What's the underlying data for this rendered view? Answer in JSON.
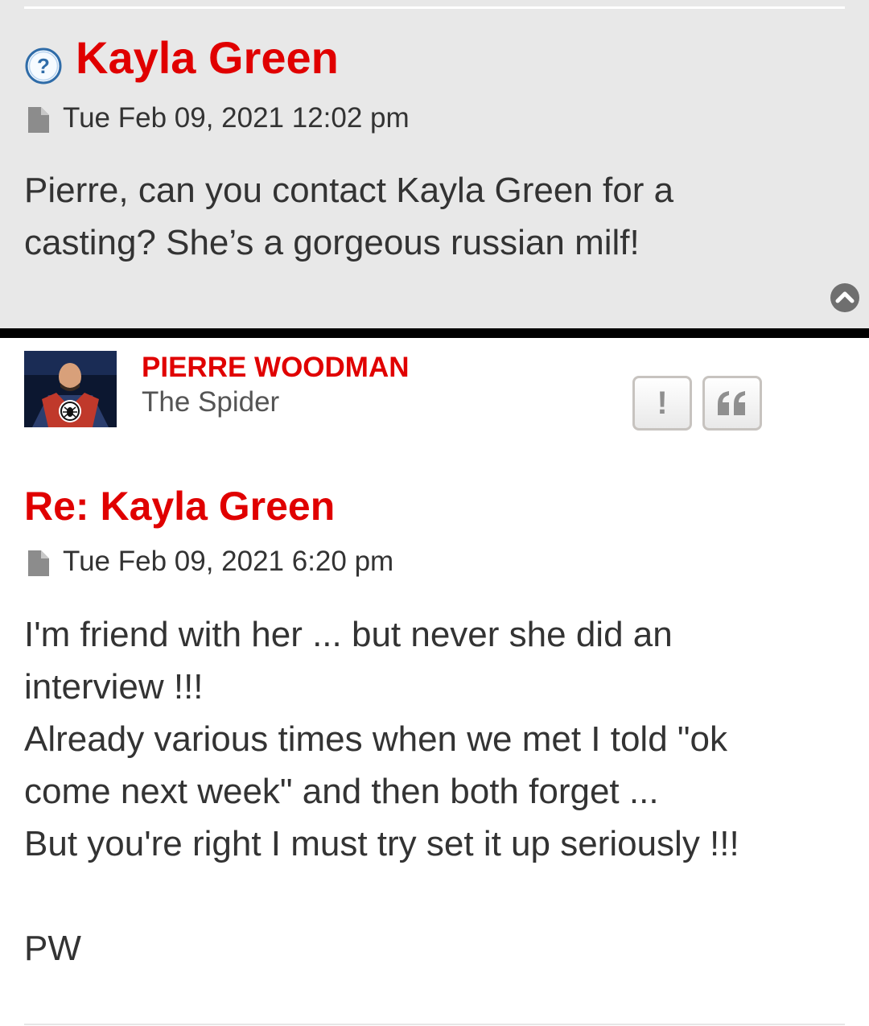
{
  "post1": {
    "title": "Kayla Green",
    "date": "Tue Feb 09, 2021 12:02 pm",
    "body_lines": [
      "Pierre, can you contact Kayla Green for a",
      "casting? She’s a gorgeous russian milf!"
    ],
    "icons": {
      "status": "question-icon",
      "post": "file-icon",
      "back_to_top": "chevron-up-icon"
    }
  },
  "post2": {
    "author": "PIERRE WOODMAN",
    "rank": "The Spider",
    "report_label": "!",
    "title": "Re: Kayla Green",
    "date": "Tue Feb 09, 2021 6:20 pm",
    "body_lines": [
      "I'm friend with her ... but never she did an",
      "interview !!!",
      "Already various times when we met I told \"ok",
      "come next week\" and then both forget ...",
      "But you're right I must try set it up seriously !!!",
      "",
      "PW"
    ],
    "icons": {
      "post": "file-icon",
      "report": "exclamation-icon",
      "quote": "quote-icon",
      "avatar": "avatar"
    }
  },
  "colors": {
    "accent": "#e00000",
    "text": "#333333",
    "post_bg": "#e8e8e8",
    "divider": "#000000"
  }
}
